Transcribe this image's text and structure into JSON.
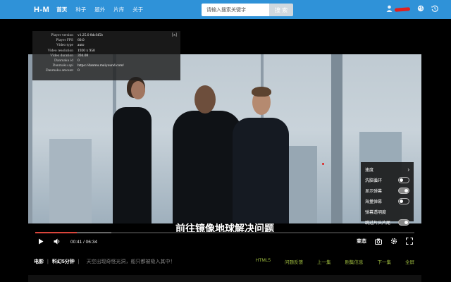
{
  "header": {
    "logo": "H-M",
    "nav": [
      {
        "label": "首页",
        "active": true
      },
      {
        "label": "种子",
        "active": false
      },
      {
        "label": "题外",
        "active": false
      },
      {
        "label": "片库",
        "active": false
      },
      {
        "label": "关于",
        "active": false
      }
    ],
    "search": {
      "placeholder": "请输入搜索关键字",
      "button": "搜 索"
    },
    "icons": [
      "user-icon",
      "theme-icon",
      "history-icon"
    ]
  },
  "player": {
    "info": {
      "close": "[x]",
      "rows": [
        {
          "key": "Player version",
          "value": "v1.25.0 8dcf45b"
        },
        {
          "key": "Player FPS",
          "value": "60.0"
        },
        {
          "key": "Video type",
          "value": "auto"
        },
        {
          "key": "Video resolution",
          "value": "1920 x 950"
        },
        {
          "key": "Video duration",
          "value": "394.08"
        },
        {
          "key": "Danmaku id",
          "value": "0"
        },
        {
          "key": "Danmaku api",
          "value": "https://danmu.maiyound.com/"
        },
        {
          "key": "Danmaku amount",
          "value": "0"
        }
      ]
    },
    "subtitle": "前往镜像地球解决问题",
    "settings": [
      {
        "label": "速度",
        "type": "arrow"
      },
      {
        "label": "洗脑循环",
        "type": "toggle",
        "on": false
      },
      {
        "label": "显示弹幕",
        "type": "toggle",
        "on": true
      },
      {
        "label": "海量弹幕",
        "type": "toggle",
        "on": false
      },
      {
        "label": "弹幕透明度",
        "type": "none"
      },
      {
        "label": "跳过片头片尾",
        "type": "toggle",
        "on": true
      }
    ],
    "progress": {
      "played_fraction": 0.11,
      "buffered_fraction": 0.2
    },
    "time": "00:41 / 06:34",
    "speed_label": "变态"
  },
  "bottom": {
    "category": "电影",
    "title": "科幻5分钟",
    "description": "天空出现奇怪光洞，船只都被吸入其中！",
    "links": [
      "HTML5",
      "问题反馈",
      "上一集",
      "剧集信息",
      "下一集",
      "全屏"
    ]
  }
}
